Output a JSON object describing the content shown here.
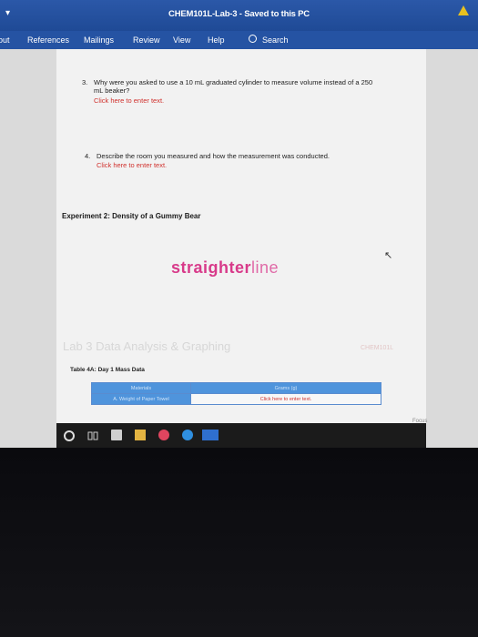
{
  "window": {
    "title": "CHEM101L-Lab-3 - Saved to this PC",
    "qat_glyph": "▾"
  },
  "ribbon": {
    "tabs": [
      "out",
      "References",
      "Mailings",
      "Review",
      "View",
      "Help"
    ],
    "search_label": "Search"
  },
  "document": {
    "q3": {
      "number": "3.",
      "text_line1": "Why were you asked to use a 10 mL graduated cylinder to measure volume instead of a 250",
      "text_line2": "mL beaker?",
      "placeholder": "Click here to enter text."
    },
    "q4": {
      "number": "4.",
      "text_line1": "Describe the room you measured and how the measurement was conducted.",
      "placeholder": "Click here to enter text."
    },
    "experiment_heading": "Experiment 2: Density of a Gummy Bear",
    "brand": {
      "part1": "straighter",
      "part2": "line"
    },
    "banner": "Lab 3 Data Analysis & Graphing",
    "course_code": "CHEM101L",
    "table_caption": "Table 4A: Day 1 Mass Data",
    "table": {
      "headers": [
        "Materials",
        "Grams (g)"
      ],
      "rows": [
        {
          "material": "A. Weight of Paper Towel",
          "value": "Click here to enter text."
        }
      ]
    },
    "focus_label": "Focus"
  },
  "taskbar": {
    "icons": [
      "search-icon",
      "task-view-icon",
      "store-icon",
      "folder-icon",
      "app-icon",
      "edge-icon",
      "word-icon"
    ]
  },
  "colors": {
    "title_bar": "#2b58a8",
    "accent_red": "#d0312d",
    "brand_pink": "#d83a8a",
    "table_blue": "#4f94dc"
  }
}
